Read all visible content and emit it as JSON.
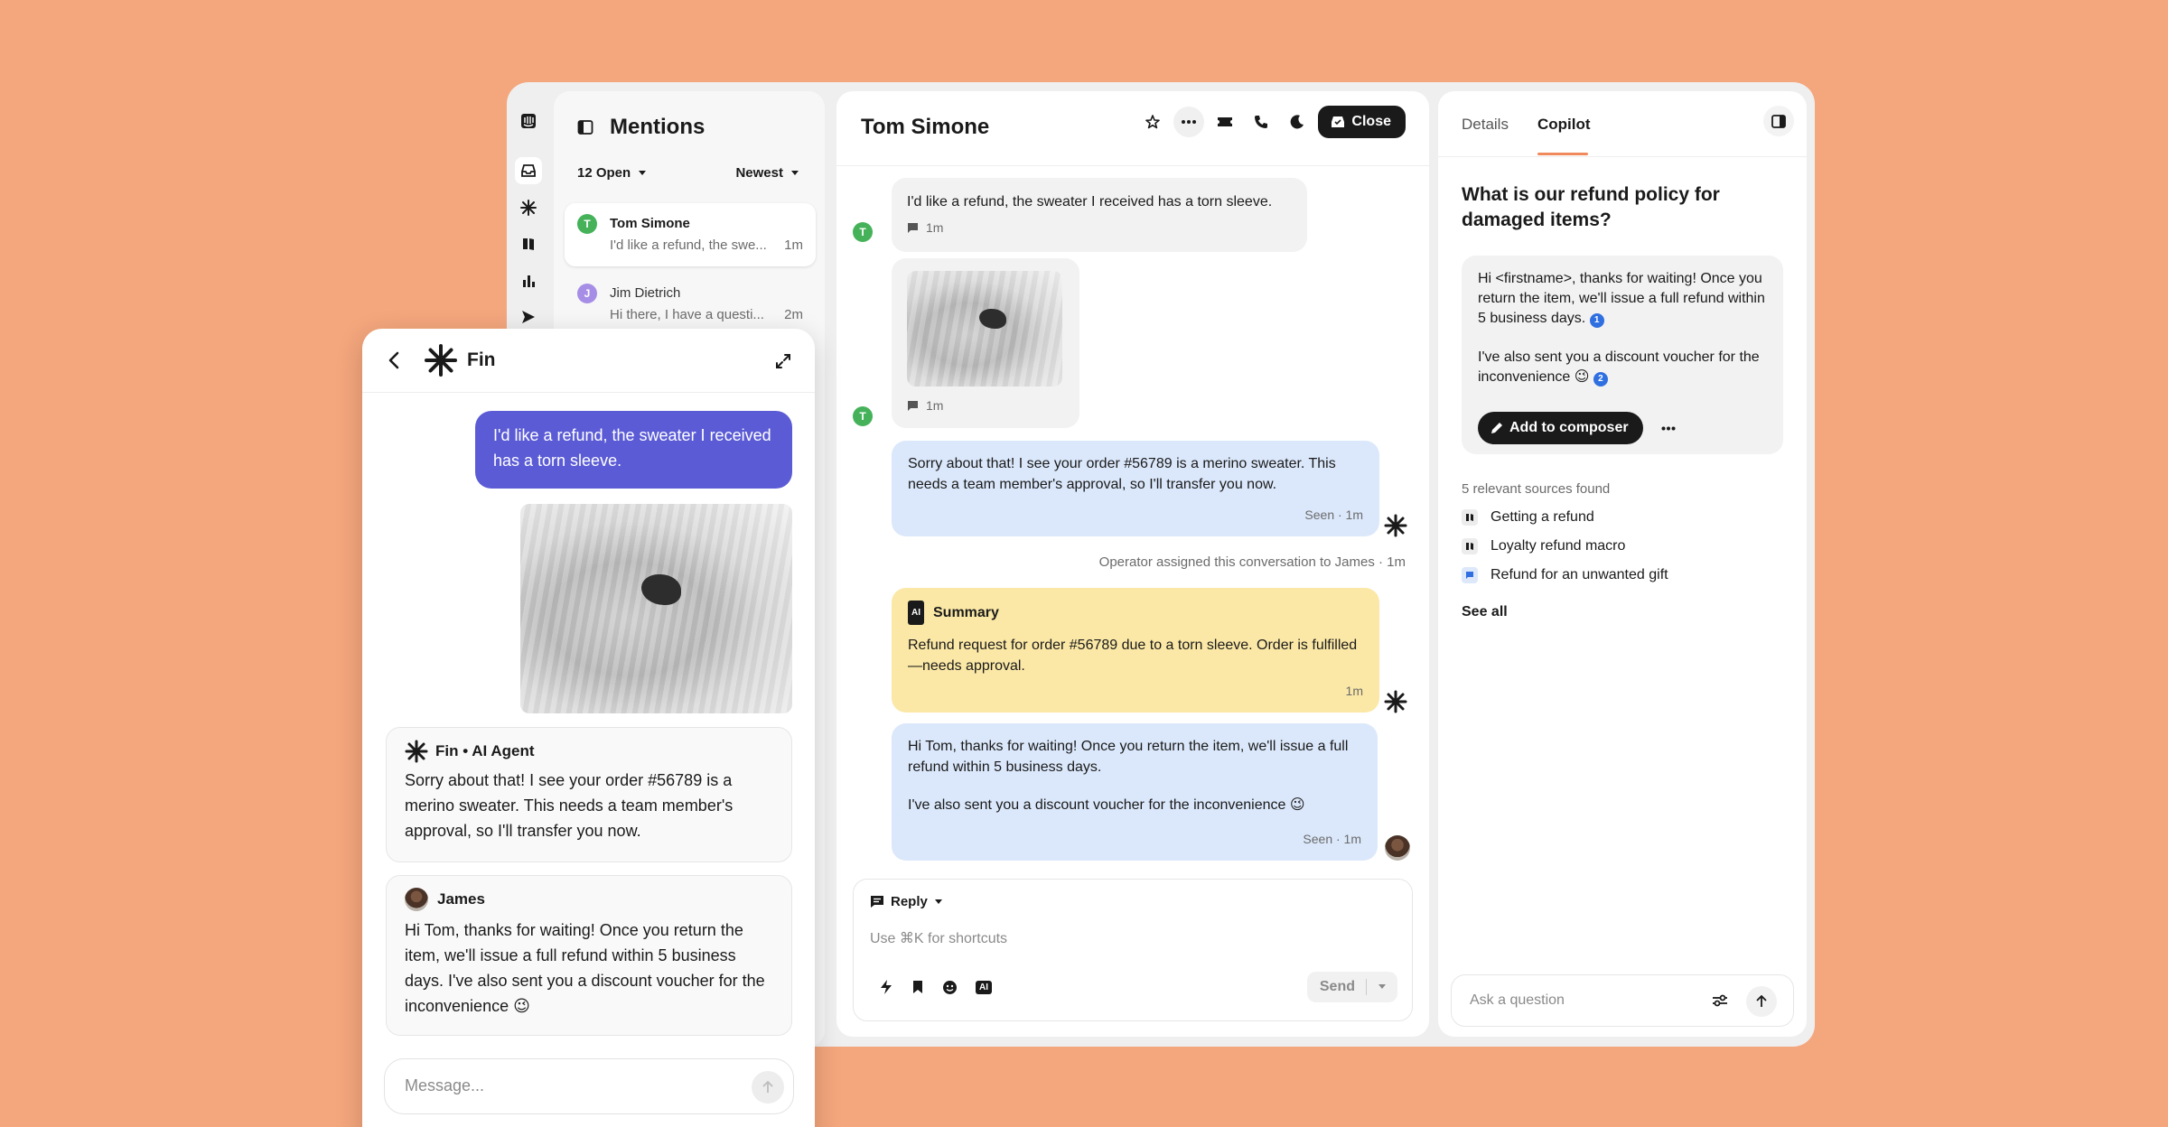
{
  "colors": {
    "background": "#f4a67c",
    "accent_purple": "#5b5bd6",
    "ai_blue": "#dbe8fb",
    "summary_yellow": "#fbe8a6",
    "close_button": "#1a1a1a"
  },
  "rail": {
    "icons": [
      "inbox-logo-icon",
      "inbox-icon",
      "fin-icon",
      "book-icon",
      "chart-icon",
      "send-icon"
    ]
  },
  "mentions": {
    "title": "Mentions",
    "filter_open": "12 Open",
    "sort": "Newest",
    "items": [
      {
        "initial": "T",
        "name": "Tom Simone",
        "preview": "I'd like a refund, the swe...",
        "time": "1m",
        "color": "#45b25a"
      },
      {
        "initial": "J",
        "name": "Jim Dietrich",
        "preview": "Hi there, I have a questi...",
        "time": "2m",
        "color": "#a68ee6"
      }
    ]
  },
  "conversation": {
    "title": "Tom Simone",
    "close_label": "Close",
    "messages": {
      "m1_text": "I'd like a refund, the sweater I received has a torn sleeve.",
      "m1_time": "1m",
      "m2_time": "1m",
      "m3_text": "Sorry about that! I see your order #56789 is a merino sweater. This needs a team member's approval, so I'll transfer you now.",
      "m3_status": "Seen · 1m",
      "assign_note": "Operator assigned this conversation to James · 1m",
      "summary_badge": "AI",
      "summary_title": "Summary",
      "summary_text": "Refund request for order #56789 due to a torn sleeve. Order is fulfilled—needs approval.",
      "summary_time": "1m",
      "m5_line1": "Hi Tom, thanks for waiting! Once you return the item, we'll issue a full refund within 5 business days.",
      "m5_line2": "I've also sent you a discount voucher for the inconvenience 😉",
      "m5_status": "Seen · 1m",
      "customer_initial": "T"
    },
    "composer": {
      "mode": "Reply",
      "placeholder": "Use ⌘K for shortcuts",
      "ai_badge": "AI",
      "send": "Send"
    }
  },
  "side": {
    "tabs": [
      "Details",
      "Copilot"
    ],
    "active_tab": "Copilot",
    "question": "What is our refund policy for damaged items?",
    "answer_p1": "Hi <firstname>, thanks for waiting! Once you return the item, we'll issue a full refund within 5 business days.",
    "ref1": "1",
    "answer_p2": "I've also sent you a discount voucher for the inconvenience 😉",
    "ref2": "2",
    "add_to_composer": "Add to composer",
    "sources_title": "5 relevant sources found",
    "sources": [
      "Getting a refund",
      "Loyalty refund macro",
      "Refund for an unwanted gift"
    ],
    "see_all": "See all",
    "ask_placeholder": "Ask a question"
  },
  "widget": {
    "title": "Fin",
    "user_message": "I'd like a refund, the sweater I received has a torn sleeve.",
    "fin_name": "Fin • AI Agent",
    "fin_text": "Sorry about that! I see your order #56789 is a merino sweater. This needs a team member's approval, so I'll transfer you now.",
    "agent_name": "James",
    "agent_text": "Hi Tom, thanks for waiting! Once you return the item, we'll issue a full refund within 5 business days. I've also sent you a discount voucher for the inconvenience 😉",
    "input_placeholder": "Message..."
  }
}
